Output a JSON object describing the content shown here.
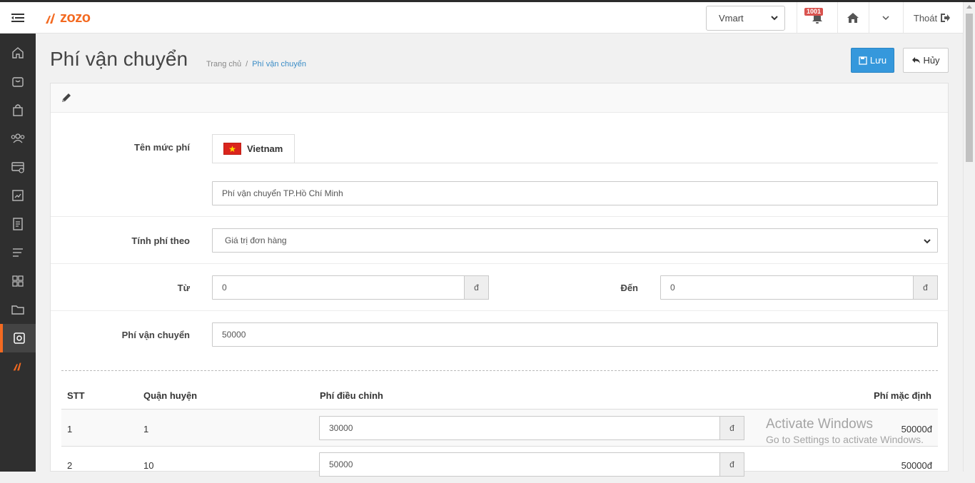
{
  "topbar": {
    "logo_text": "zozo",
    "store_selected": "Vmart",
    "notification_count": "1001",
    "logout_label": "Thoát"
  },
  "sidebar": {
    "items": [
      {
        "icon": "home-icon"
      },
      {
        "icon": "shopping-bag-icon"
      },
      {
        "icon": "product-bag-icon"
      },
      {
        "icon": "users-icon"
      },
      {
        "icon": "promotion-card-icon"
      },
      {
        "icon": "report-icon"
      },
      {
        "icon": "document-icon"
      },
      {
        "icon": "list-icon"
      },
      {
        "icon": "apps-icon"
      },
      {
        "icon": "folder-icon"
      },
      {
        "icon": "settings-icon",
        "active": true
      },
      {
        "icon": "brand-icon"
      }
    ]
  },
  "page": {
    "title": "Phí vận chuyển",
    "breadcrumb": [
      "Trang chủ",
      "/",
      "Phí vận chuyển"
    ],
    "save_label": "Lưu",
    "cancel_label": "Hủy"
  },
  "form": {
    "fee_name_label": "Tên mức phí",
    "lang_tab": "Vietnam",
    "fee_name_value": "Phí vận chuyển TP.Hồ Chí Minh",
    "calc_by_label": "Tính phí theo",
    "calc_by_value": "Giá trị đơn hàng",
    "from_label": "Từ",
    "from_value": "0",
    "to_label": "Đến",
    "to_value": "0",
    "currency": "đ",
    "shipping_fee_label": "Phí vận chuyển",
    "shipping_fee_value": "50000"
  },
  "table": {
    "headers": [
      "STT",
      "Quận huyện",
      "Phí điều chỉnh",
      "Phí mặc định"
    ],
    "rows": [
      {
        "stt": "1",
        "district": "1",
        "adjusted": "30000",
        "default": "50000đ"
      },
      {
        "stt": "2",
        "district": "10",
        "adjusted": "50000",
        "default": "50000đ"
      }
    ]
  },
  "watermark": {
    "line1": "Activate Windows",
    "line2": "Go to Settings to activate Windows."
  },
  "colors": {
    "brand": "#f36a21",
    "primary": "#3598dc",
    "sidebar": "#2f2f2f"
  }
}
